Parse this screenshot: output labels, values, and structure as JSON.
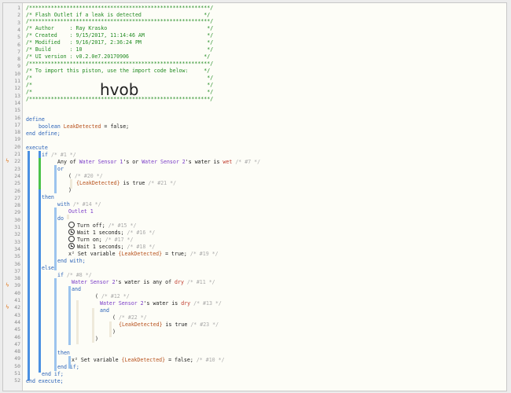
{
  "header": {
    "line1": "/**********************************************************/",
    "title": "/* Flash Outlet if a leak is detected                    */",
    "line3": "/**********************************************************/",
    "author": "/* Author     : Ray Krasko                                */",
    "created": "/* Created    : 9/15/2017, 11:14:46 AM                    */",
    "modified": "/* Modified   : 9/16/2017, 2:36:24 PM                     */",
    "build": "/* Build      : 10                                        */",
    "ui_version": "/* UI version : v0.2.0e7.20170906                        */",
    "line9": "/**********************************************************/",
    "import_note": "/* To import this piston, use the import code below:     */",
    "blank1": "/*                                                        */",
    "blank2": "/*                                                        */",
    "blank3": "/*                                                        */",
    "line14": "/**********************************************************/",
    "import_code": "hvob"
  },
  "line_numbers": [
    "1",
    "2",
    "3",
    "4",
    "5",
    "6",
    "7",
    "8",
    "9",
    "10",
    "11",
    "12",
    "13",
    "14",
    "15",
    "16",
    "17",
    "18",
    "19",
    "20",
    "21",
    "22",
    "23",
    "24",
    "25",
    "26",
    "27",
    "28",
    "29",
    "30",
    "31",
    "32",
    "33",
    "34",
    "35",
    "36",
    "37",
    "38",
    "39",
    "40",
    "41",
    "42",
    "43",
    "44",
    "45",
    "46",
    "47",
    "48",
    "49",
    "50",
    "51",
    "52"
  ],
  "marker_glyph": "ϟ",
  "code": {
    "define": "define",
    "boolean": "boolean",
    "leak_var": "LeakDetected",
    "eq_false": " = false;",
    "end_define": "end define;",
    "execute": "execute",
    "if": "if",
    "c1": "/* #1 */",
    "any_of": "Any of ",
    "ws1": "Water Sensor 1",
    "s_or": "'s or ",
    "ws2": "Water Sensor 2",
    "s_water_is": "'s water is ",
    "wet": "wet",
    "c7": " /* #7 */",
    "or": "or",
    "paren_open": "(",
    "c20": " /* #20 */",
    "leak_expr": "{LeakDetected}",
    "is_true": " is true ",
    "c21": "/* #21 */",
    "paren_close": ")",
    "then": "then",
    "with": "with",
    "c14": " /* #14 */",
    "outlet1": "Outlet 1",
    "do": "do",
    "turn_off": "Turn off; ",
    "c15": "/* #15 */",
    "wait1": "Wait 1 seconds; ",
    "c16": "/* #16 */",
    "turn_on": "Turn on; ",
    "c17": "/* #17 */",
    "c18": "/* #18 */",
    "x2": "x²",
    "set_variable": " Set variable ",
    "eq_true": " = true; ",
    "c19": "/* #19 */",
    "end_with": "end with;",
    "else": "else",
    "c8": " /* #8 */",
    "water_is_any_of": "'s water is any of ",
    "dry": "dry",
    "c11": " /* #11 */",
    "and": "and",
    "c12": " /* #12 */",
    "s_water_is2": "'s water is ",
    "c13": " /* #13 */",
    "c22": " /* #22 */",
    "c23": "/* #23 */",
    "eq_false2": " = false; ",
    "c10": "/* #10 */",
    "end_if": "end if;",
    "end_execute": "end execute;"
  }
}
